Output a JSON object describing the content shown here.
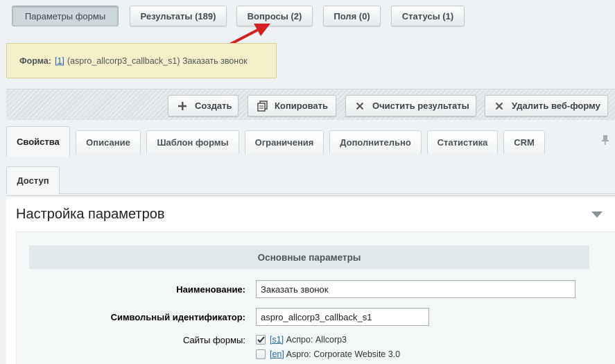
{
  "top_tabs": [
    {
      "label": "Параметры формы",
      "active": true
    },
    {
      "label": "Результаты (189)",
      "active": false
    },
    {
      "label": "Вопросы (2)",
      "active": false
    },
    {
      "label": "Поля (0)",
      "active": false
    },
    {
      "label": "Статусы (1)",
      "active": false
    }
  ],
  "form_note": {
    "label": "Форма:",
    "id_link": "[1]",
    "text": "(aspro_allcorp3_callback_s1) Заказать звонок"
  },
  "annotation": {
    "arrow_color": "#d42020"
  },
  "toolbar": {
    "create": "Создать",
    "copy": "Копировать",
    "clear_results": "Очистить результаты",
    "delete_form": "Удалить веб-форму"
  },
  "tabs": [
    {
      "label": "Свойства",
      "active": true
    },
    {
      "label": "Описание",
      "active": false
    },
    {
      "label": "Шаблон формы",
      "active": false
    },
    {
      "label": "Ограничения",
      "active": false
    },
    {
      "label": "Дополнительно",
      "active": false
    },
    {
      "label": "Статистика",
      "active": false
    },
    {
      "label": "CRM",
      "active": false
    }
  ],
  "tabs_row2": [
    {
      "label": "Доступ",
      "active": false
    }
  ],
  "panel": {
    "title": "Настройка параметров",
    "section": "Основные параметры",
    "fields": {
      "name_label": "Наименование:",
      "name_value": "Заказать звонок",
      "code_label": "Символьный идентификатор:",
      "code_value": "aspro_allcorp3_callback_s1",
      "sites_label": "Сайты формы:"
    },
    "sites": [
      {
        "code": "[s1]",
        "name": "Аспро: Allcorp3",
        "checked": true
      },
      {
        "code": "[en]",
        "name": "Aspro: Corporate Website 3.0",
        "checked": false
      }
    ]
  },
  "icons": {
    "create": "plus-icon",
    "copy": "copy-icon",
    "clear": "close-icon",
    "delete": "close-icon",
    "pin": "pin-icon",
    "collapse": "triangle-down-icon"
  }
}
